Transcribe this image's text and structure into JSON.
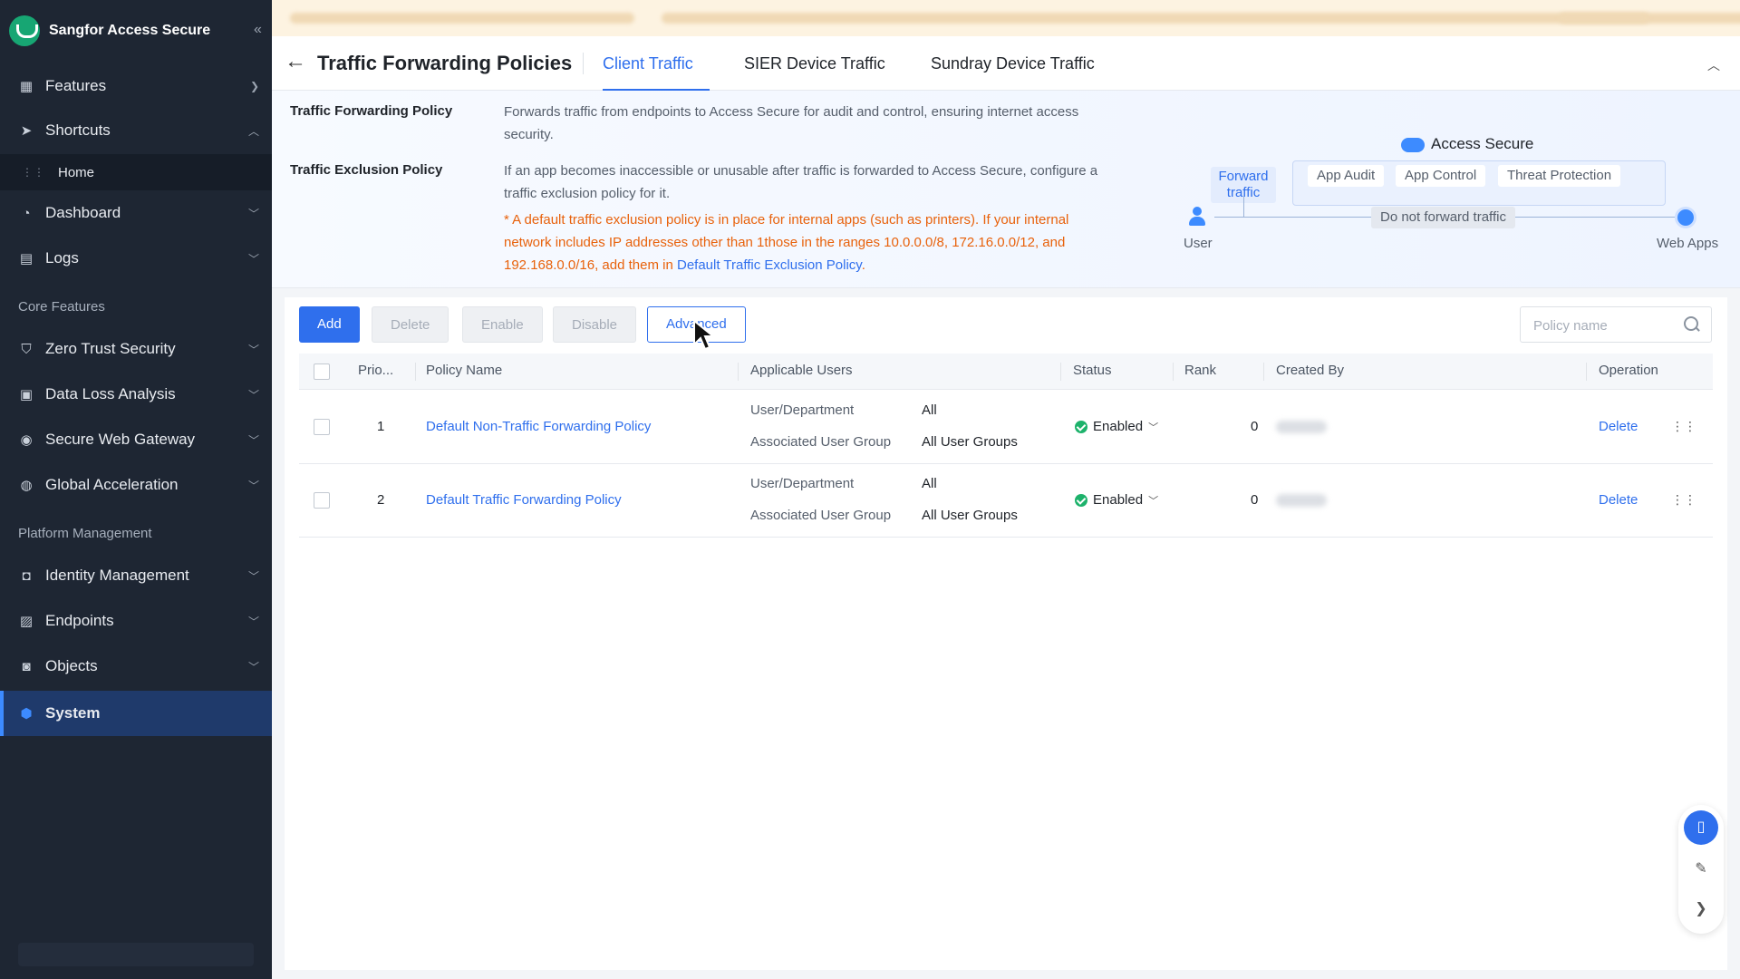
{
  "sidebar": {
    "brand": "Sangfor Access Secure",
    "collapse_icon": "«",
    "items": [
      {
        "label": "Features",
        "icon": "grid-icon"
      },
      {
        "label": "Shortcuts",
        "icon": "send-icon"
      },
      {
        "label": "Home"
      },
      {
        "label": "Dashboard",
        "icon": "dashboard-icon"
      },
      {
        "label": "Logs",
        "icon": "logs-icon"
      },
      {
        "label": "Zero Trust Security",
        "icon": "shield-icon"
      },
      {
        "label": "Data Loss Analysis",
        "icon": "data-icon"
      },
      {
        "label": "Secure Web Gateway",
        "icon": "gateway-icon"
      },
      {
        "label": "Global Acceleration",
        "icon": "globe-icon"
      },
      {
        "label": "Identity Management",
        "icon": "identity-icon"
      },
      {
        "label": "Endpoints",
        "icon": "endpoint-icon"
      },
      {
        "label": "Objects",
        "icon": "objects-icon"
      },
      {
        "label": "System",
        "icon": "system-icon"
      }
    ],
    "sections": {
      "core": "Core Features",
      "platform": "Platform Management"
    }
  },
  "header": {
    "title": "Traffic Forwarding Policies",
    "tabs": [
      {
        "label": "Client Traffic",
        "active": true
      },
      {
        "label": "SIER Device Traffic",
        "active": false
      },
      {
        "label": "Sundray Device Traffic",
        "active": false
      }
    ]
  },
  "info": {
    "forwarding_label": "Traffic Forwarding Policy",
    "forwarding_text": "Forwards traffic from endpoints to Access Secure for audit and control, ensuring internet access security.",
    "exclusion_label": "Traffic Exclusion Policy",
    "exclusion_text": "If an app becomes inaccessible or unusable after traffic is forwarded to Access Secure, configure a traffic exclusion policy for it.",
    "warning_text": "* A default traffic exclusion policy is in place for internal apps (such as printers). If your internal network includes IP addresses other than 1those in the ranges 10.0.0.0/8, 172.16.0.0/12, and 192.168.0.0/16, add them in",
    "warning_link": "Default Traffic Exclusion Policy",
    "warning_end": "."
  },
  "diagram": {
    "title": "Access Secure",
    "forward_label": "Forward traffic",
    "tags": [
      "App Audit",
      "App Control",
      "Threat Protection"
    ],
    "no_forward_label": "Do not forward traffic",
    "user_label": "User",
    "web_label": "Web Apps"
  },
  "toolbar": {
    "add": "Add",
    "delete": "Delete",
    "enable": "Enable",
    "disable": "Disable",
    "advanced": "Advanced",
    "search_placeholder": "Policy name"
  },
  "table": {
    "columns": [
      "Prio...",
      "Policy Name",
      "Applicable Users",
      "Status",
      "Rank",
      "Created By",
      "Operation"
    ],
    "rows": [
      {
        "priority": "1",
        "name": "Default Non-Traffic Forwarding Policy",
        "user_dept_label": "User/Department",
        "user_dept_value": "All",
        "group_label": "Associated User Group",
        "group_value": "All User Groups",
        "status": "Enabled",
        "rank": "0",
        "operation": "Delete"
      },
      {
        "priority": "2",
        "name": "Default Traffic Forwarding Policy",
        "user_dept_label": "User/Department",
        "user_dept_value": "All",
        "group_label": "Associated User Group",
        "group_value": "All User Groups",
        "status": "Enabled",
        "rank": "0",
        "operation": "Delete"
      }
    ]
  },
  "colors": {
    "accent": "#2f6fed",
    "sidebar_bg": "#1e2633",
    "status_enabled": "#1db26b",
    "warning": "#e8620c"
  }
}
